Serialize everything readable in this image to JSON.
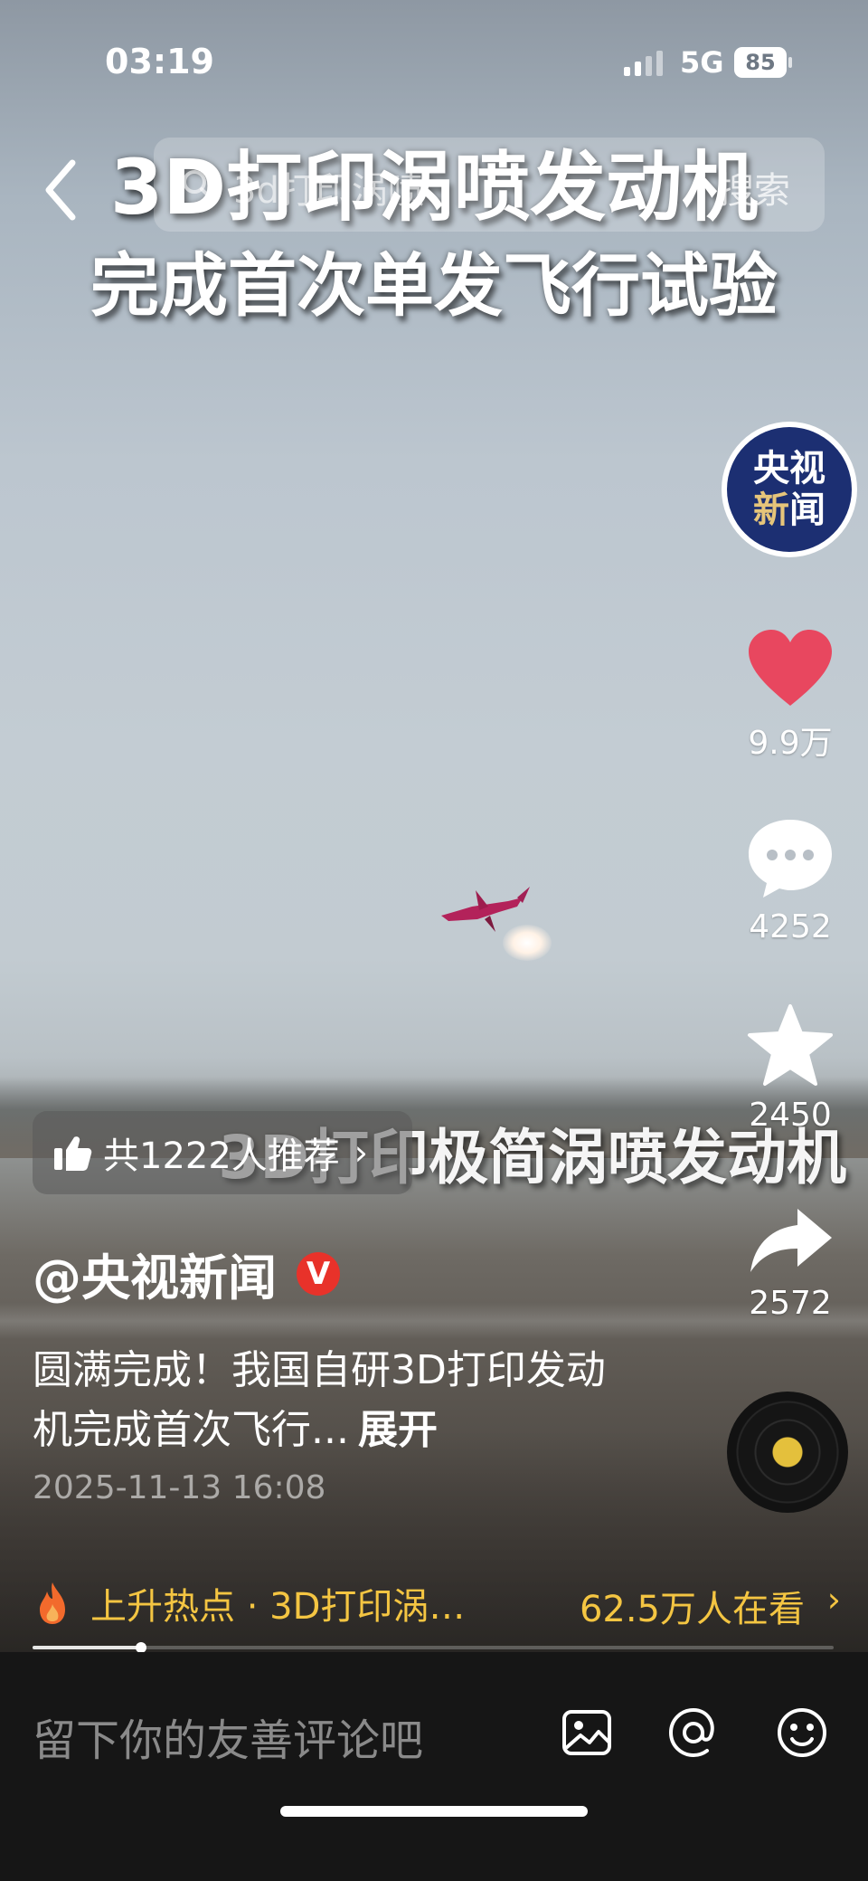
{
  "status_bar": {
    "time": "03:19",
    "network": "5G",
    "battery": "85"
  },
  "search": {
    "placeholder": "3d打印涡喷",
    "button": "搜索"
  },
  "video": {
    "title_line1": "3D打印涡喷发动机",
    "title_line2": "完成首次单发飞行试验",
    "caption": "3D打印极简涡喷发动机"
  },
  "actions": {
    "likes": "9.9万",
    "comments": "4252",
    "favorites": "2450",
    "shares": "2572"
  },
  "avatar": {
    "line1": "央视",
    "line2a": "新",
    "line2b": "闻"
  },
  "recommend": {
    "text": "共1222人推荐",
    "chevron": "›"
  },
  "author": {
    "name": "@央视新闻",
    "verified": "V"
  },
  "description": {
    "text": "圆满完成！我国自研3D打印发动机完成首次飞行...",
    "expand": "展开"
  },
  "timestamp": "2025-11-13 16:08",
  "hot": {
    "text": "上升热点 · 3D打印涡…",
    "viewers": "62.5万人在看",
    "chevron": "›"
  },
  "progress": {
    "fraction": 0.135
  },
  "comment_bar": {
    "placeholder": "留下你的友善评论吧"
  },
  "colors": {
    "like": "#e8475f",
    "hot": "#f4c542",
    "verified": "#e8322a",
    "avatar_bg": "#1c2f72"
  }
}
